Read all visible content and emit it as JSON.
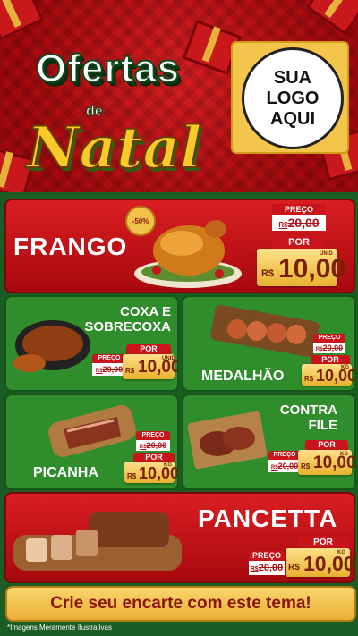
{
  "header": {
    "title_line1": "Ofertas",
    "title_line2": "de",
    "title_line3": "Natal",
    "logo_line1": "SUA",
    "logo_line2": "LOGO",
    "logo_line3": "AQUI"
  },
  "products": [
    {
      "name": "FRANGO",
      "badge": "-50%",
      "old_label": "PREÇO",
      "old_currency": "R$",
      "old_price": "20,00",
      "new_label": "POR",
      "currency": "R$",
      "price": "10,00",
      "unit": "UNID"
    },
    {
      "name": "COXA E SOBRECOXA",
      "old_label": "PREÇO",
      "old_currency": "R$",
      "old_price": "20,00",
      "new_label": "POR",
      "currency": "R$",
      "price": "10,00",
      "unit": "UNID"
    },
    {
      "name": "MEDALHÃO",
      "old_label": "PREÇO",
      "old_currency": "R$",
      "old_price": "20,00",
      "new_label": "POR",
      "currency": "R$",
      "price": "10,00",
      "unit": "KG"
    },
    {
      "name": "PICANHA",
      "old_label": "PREÇO",
      "old_currency": "R$",
      "old_price": "20,00",
      "new_label": "POR",
      "currency": "R$",
      "price": "10,00",
      "unit": "KG"
    },
    {
      "name": "CONTRA FILE",
      "old_label": "PREÇO",
      "old_currency": "R$",
      "old_price": "20,00",
      "new_label": "POR",
      "currency": "R$",
      "price": "10,00",
      "unit": "KG"
    },
    {
      "name": "PANCETTA",
      "old_label": "PREÇO",
      "old_currency": "R$",
      "old_price": "20,00",
      "new_label": "POR",
      "currency": "R$",
      "price": "10,00",
      "unit": "KG"
    }
  ],
  "footer": {
    "cta": "Crie seu encarte com este tema!",
    "disclaimer": "*Imagens Meramente Ilustrativas"
  },
  "colors": {
    "red": "#c8141a",
    "green": "#2f8d2b",
    "gold": "#f2c14a"
  }
}
